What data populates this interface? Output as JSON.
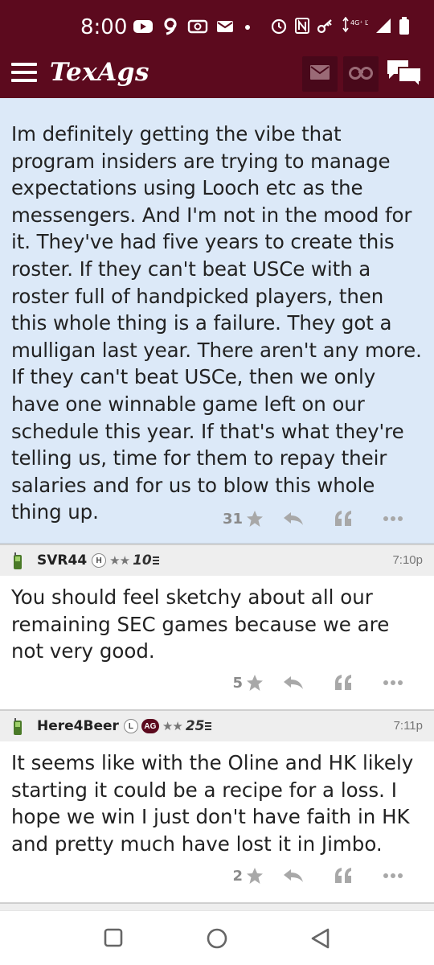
{
  "status_bar": {
    "time": "8:00",
    "network": "4G⁺ LTE",
    "icons": [
      "youtube-icon",
      "nine-icon",
      "radio-icon",
      "mail-icon",
      "dot-icon",
      "alarm-icon",
      "nfc-icon",
      "key-icon",
      "data-icon",
      "signal-icon",
      "battery-icon"
    ]
  },
  "header": {
    "logo": "TexAgs",
    "icons": [
      "menu-icon",
      "mail-icon",
      "binoculars-icon",
      "chat-icon"
    ],
    "brand_color": "#5c0a1e"
  },
  "posts": [
    {
      "type": "op",
      "body": "Im definitely getting the vibe that program insiders are trying to manage expectations using Looch etc as the messengers. And I'm not in the mood for it. They've had five years to create this roster. If they can't beat USCe with a roster full of handpicked players, then this whole thing is a failure. They got a mulligan last year. There aren't any more. If they can't beat USCe, then we only have one winnable game left on our schedule this year. If that's what they're telling us, time for them to repay their salaries and for us to blow this whole thing up.",
      "likes": "31"
    },
    {
      "type": "reply",
      "username": "SVR44",
      "badges": [
        "H"
      ],
      "stars": "★★",
      "rank": "10",
      "timestamp": "7:10p",
      "body": "You should feel sketchy about all our remaining SEC games because we are not very good.",
      "likes": "5"
    },
    {
      "type": "reply",
      "username": "Here4Beer",
      "badges": [
        "L",
        "AG"
      ],
      "stars": "★★",
      "rank": "25",
      "timestamp": "7:11p",
      "body": "It seems like with the Oline and HK likely starting it could be a recipe for a loss. I hope we win I just don't have faith in HK and pretty much have lost it in Jimbo.",
      "likes": "2"
    }
  ],
  "nav_bar": {
    "icons": [
      "recents-icon",
      "home-icon",
      "back-icon"
    ]
  }
}
